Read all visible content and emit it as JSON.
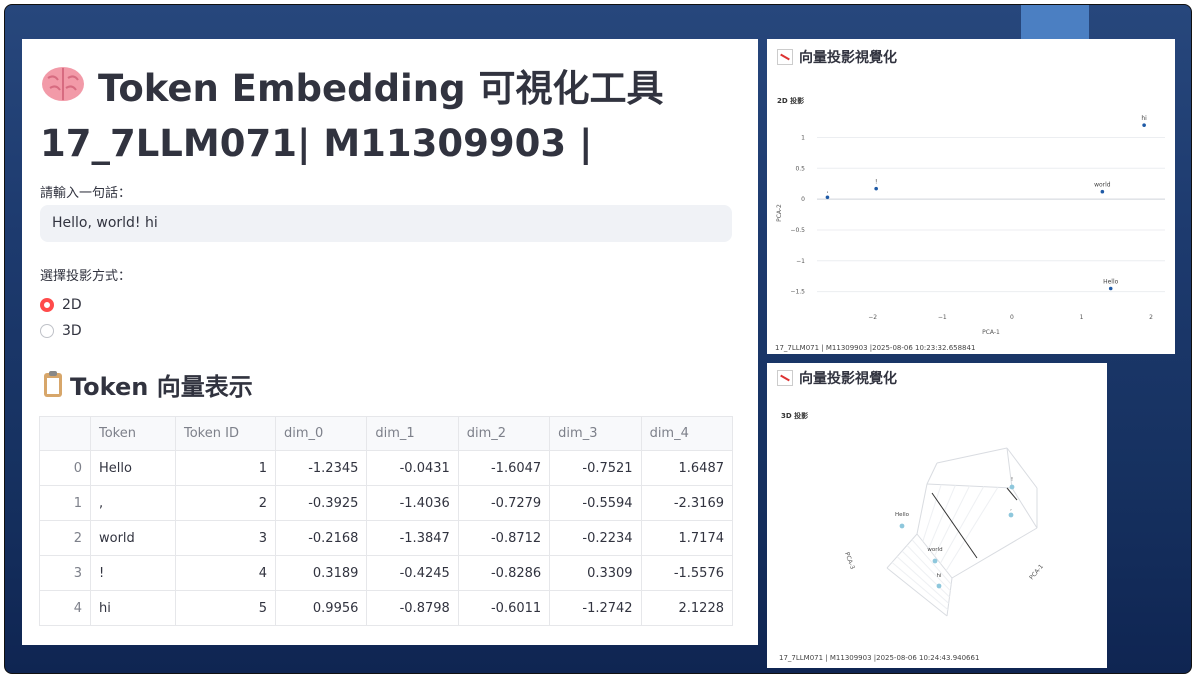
{
  "app": {
    "title": "Token Embedding 可視化工具",
    "subtitle": "17_7LLM071| M11309903 |",
    "brain_icon": "brain-icon"
  },
  "input": {
    "label": "請輸入一句話：",
    "value": "Hello, world! hi"
  },
  "projection": {
    "label": "選擇投影方式：",
    "options": [
      "2D",
      "3D"
    ],
    "selected": "2D"
  },
  "vectors": {
    "heading": "Token 向量表示",
    "icon": "clipboard-icon",
    "columns": [
      "",
      "Token",
      "Token ID",
      "dim_0",
      "dim_1",
      "dim_2",
      "dim_3",
      "dim_4"
    ],
    "rows": [
      [
        "0",
        "Hello",
        "1",
        "-1.2345",
        "-0.0431",
        "-1.6047",
        "-0.7521",
        "1.6487"
      ],
      [
        "1",
        ",",
        "2",
        "-0.3925",
        "-1.4036",
        "-0.7279",
        "-0.5594",
        "-2.3169"
      ],
      [
        "2",
        "world",
        "3",
        "-0.2168",
        "-1.3847",
        "-0.8712",
        "-0.2234",
        "1.7174"
      ],
      [
        "3",
        "!",
        "4",
        "0.3189",
        "-0.4245",
        "-0.8286",
        "0.3309",
        "-1.5576"
      ],
      [
        "4",
        "hi",
        "5",
        "0.9956",
        "-0.8798",
        "-0.6011",
        "-1.2742",
        "2.1228"
      ]
    ]
  },
  "chart2d": {
    "panel_title": "向量投影視覺化",
    "footer": "17_7LLM071 | M11309903 |2025-08-06 10:23:32.658841"
  },
  "chart3d": {
    "panel_title": "向量投影視覺化",
    "footer": "17_7LLM071 | M11309903 |2025-08-06 10:24:43.940661"
  },
  "chart_data": [
    {
      "type": "scatter",
      "title": "2D 投影",
      "xlabel": "PCA-1",
      "ylabel": "PCA-2",
      "xlim": [
        -2.8,
        2.2
      ],
      "ylim": [
        -1.75,
        1.3
      ],
      "xticks": [
        -2,
        -1,
        0,
        1,
        2
      ],
      "yticks": [
        1,
        0.5,
        0,
        -0.5,
        -1,
        -1.5
      ],
      "xtick_labels": [
        "−2",
        "−1",
        "0",
        "1",
        "2"
      ],
      "ytick_labels": [
        "1",
        "0.5",
        "0",
        "−0.5",
        "−1",
        "−1.5"
      ],
      "grid": true,
      "color": "#1f5aa6",
      "points": [
        {
          "label": ",",
          "x": -2.65,
          "y": 0.03
        },
        {
          "label": "!",
          "x": -1.95,
          "y": 0.17
        },
        {
          "label": "world",
          "x": 1.3,
          "y": 0.12
        },
        {
          "label": "hi",
          "x": 1.9,
          "y": 1.2
        },
        {
          "label": "Hello",
          "x": 1.42,
          "y": -1.45
        }
      ]
    },
    {
      "type": "scatter",
      "title": "3D 投影",
      "xlabel": "PCA-1",
      "ylabel": "PCA-3",
      "grid": true,
      "color": "#8ec7dc",
      "points": [
        {
          "label": "Hello"
        },
        {
          "label": "world"
        },
        {
          "label": "hi"
        },
        {
          "label": "!"
        },
        {
          "label": ","
        }
      ]
    }
  ]
}
